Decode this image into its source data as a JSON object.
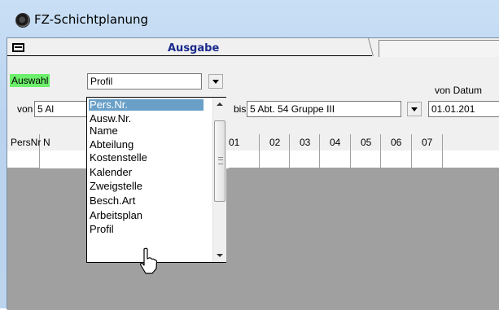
{
  "window": {
    "title": "FZ-Schichtplanung"
  },
  "tabs": {
    "active": "Ausgabe"
  },
  "auswahl": {
    "label": "Auswahl",
    "value": "Profil"
  },
  "range": {
    "von_label": "von",
    "von_value": "5 Al",
    "bis_label": "bis",
    "bis_value": "5 Abt. 54 Gruppe III",
    "von_datum_label": "von Datum",
    "datum_value": "01.01.201"
  },
  "grid": {
    "headers": [
      "PersNr",
      "N",
      "01",
      "02",
      "03",
      "04",
      "05",
      "06",
      "07"
    ]
  },
  "dropdown": {
    "items": [
      "Pers.Nr.",
      "Ausw.Nr.",
      "Name",
      "Abteilung",
      "Kostenstelle",
      "Kalender",
      "Zweigstelle",
      "Besch.Art",
      "Arbeitsplan",
      "Profil"
    ],
    "highlighted": "Pers.Nr."
  },
  "icons": {
    "app": "app-icon",
    "menu": "menu-icon",
    "cursor": "pointer-cursor-icon"
  }
}
